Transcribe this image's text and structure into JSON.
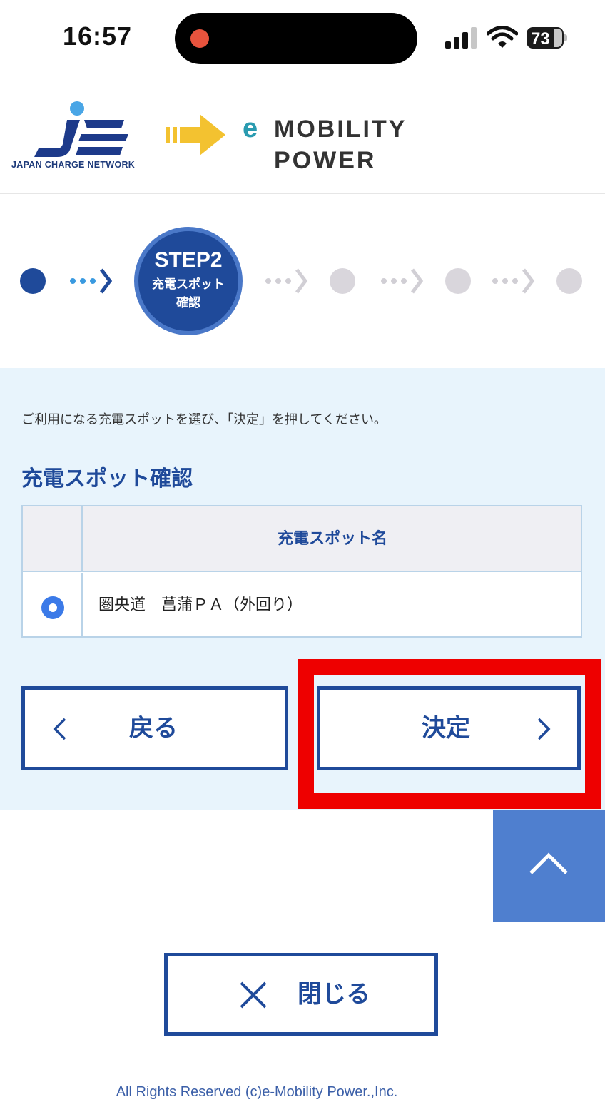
{
  "status_bar": {
    "time": "16:57",
    "battery_percent": "73",
    "icons": [
      "signal-icon",
      "wifi-icon",
      "battery-icon"
    ]
  },
  "header": {
    "left_logo_text": "JAPAN CHARGE NETWORK",
    "right_logo_line1": "MOBILITY",
    "right_logo_line2": "POWER",
    "right_logo_e": "e"
  },
  "stepper": {
    "current_title": "STEP2",
    "current_label_line1": "充電スポット",
    "current_label_line2": "確認",
    "total_steps": 6,
    "current_step": 2
  },
  "main": {
    "instruction": "ご利用になる充電スポットを選び、「決定」を押してください。",
    "section_title": "充電スポット確認",
    "table": {
      "header_name": "充電スポット名",
      "rows": [
        {
          "name": "圏央道　菖蒲ＰＡ（外回り）",
          "selected": true
        }
      ]
    },
    "back_label": "戻る",
    "ok_label": "決定"
  },
  "close_label": "閉じる",
  "footer": "All Rights Reserved (c)e-Mobility Power.,Inc.",
  "colors": {
    "brand_blue": "#1f4a9a",
    "panel_bg": "#e8f4fc",
    "radio_blue": "#3b7ae8",
    "highlight_red": "#ee0000",
    "page_top_bg": "#4f7fcf"
  }
}
